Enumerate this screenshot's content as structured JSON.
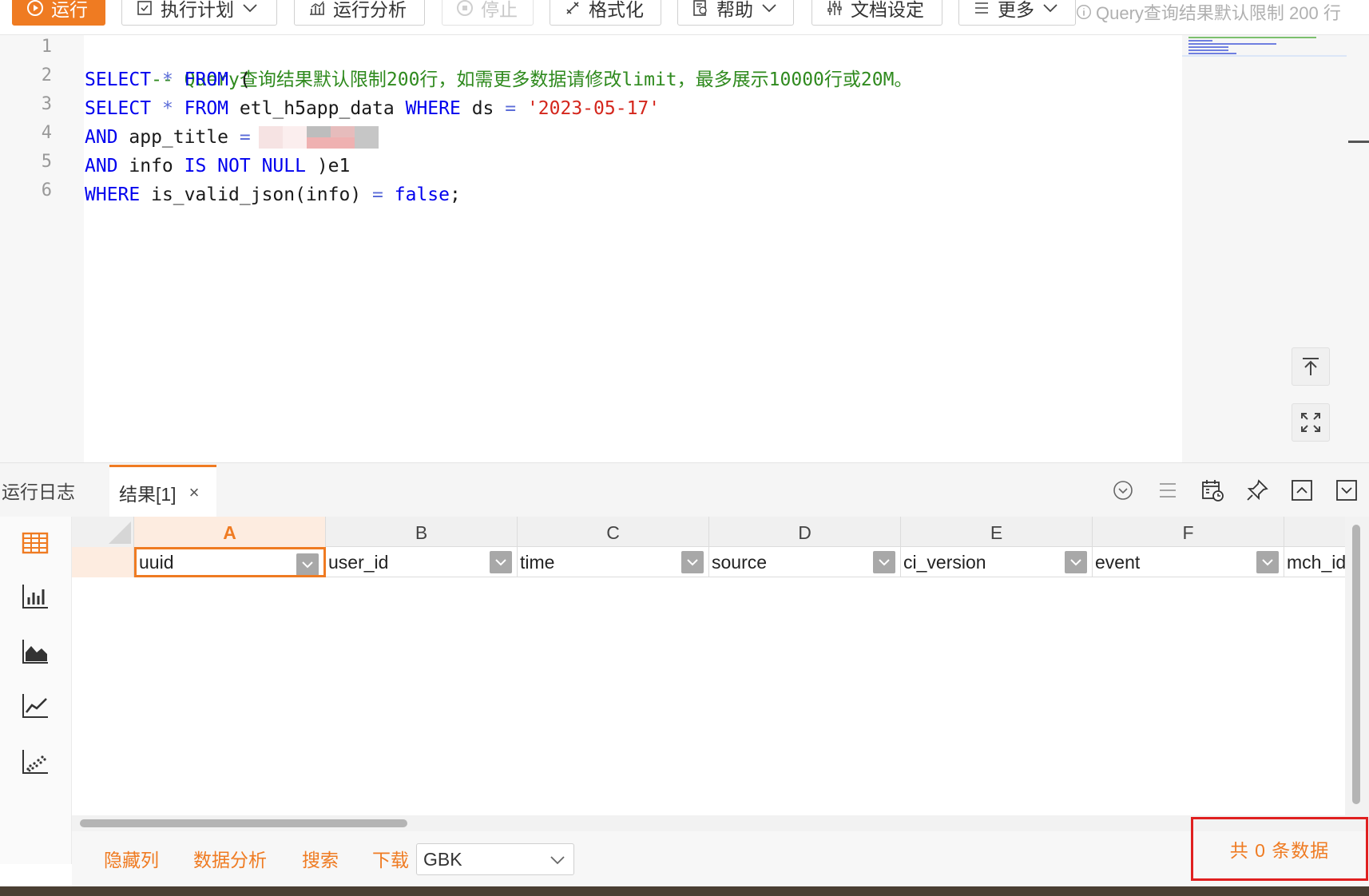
{
  "toolbar": {
    "run_label": "运行",
    "plan_label": "执行计划",
    "analyze_label": "运行分析",
    "stop_label": "停止",
    "format_label": "格式化",
    "help_label": "帮助",
    "doc_settings_label": "文档设定",
    "more_label": "更多",
    "limit_hint": "Query查询结果默认限制 200 行"
  },
  "editor": {
    "line_numbers": [
      "1",
      "2",
      "3",
      "4",
      "5",
      "6"
    ],
    "lines": {
      "l1_comment": "-- Query查询结果默认限制200行，如需更多数据请修改limit，最多展示10000行或20M。",
      "l2_select": "SELECT",
      "l2_star": " * ",
      "l2_from": "FROM",
      "l2_paren": " (",
      "l3_select": "SELECT",
      "l3_star": " * ",
      "l3_from": "FROM",
      "l3_table": " etl_h5app_data ",
      "l3_where": "WHERE",
      "l3_col": " ds ",
      "l3_eq": "=",
      "l3_value": " '2023-05-17'",
      "l4_and": "AND",
      "l4_col": " app_title ",
      "l4_eq": "=",
      "l5_and": "AND",
      "l5_col": " info ",
      "l5_is": "IS NOT NULL",
      "l5_alias": " )e1",
      "l6_where": "WHERE",
      "l6_expr": " is_valid_json(info) ",
      "l6_eq": "=",
      "l6_false": " false",
      "l6_semi": ";"
    }
  },
  "results": {
    "tab_log": "运行日志",
    "tab_result": "结果[1]",
    "tab_close": "×",
    "columns": [
      {
        "letter": "A",
        "name": "uuid"
      },
      {
        "letter": "B",
        "name": "user_id"
      },
      {
        "letter": "C",
        "name": "time"
      },
      {
        "letter": "D",
        "name": "source"
      },
      {
        "letter": "E",
        "name": "ci_version"
      },
      {
        "letter": "F",
        "name": "event"
      },
      {
        "letter": "",
        "name": "mch_id"
      }
    ]
  },
  "footer": {
    "hide_columns": "隐藏列",
    "data_analysis": "数据分析",
    "search": "搜索",
    "download": "下载",
    "encoding": "GBK",
    "total": "共 0 条数据"
  },
  "colors": {
    "accent": "#ef7b22",
    "keyword": "#0000ee",
    "string": "#d4261c",
    "comment": "#2f8a1e",
    "highlight_box": "#e02020"
  }
}
